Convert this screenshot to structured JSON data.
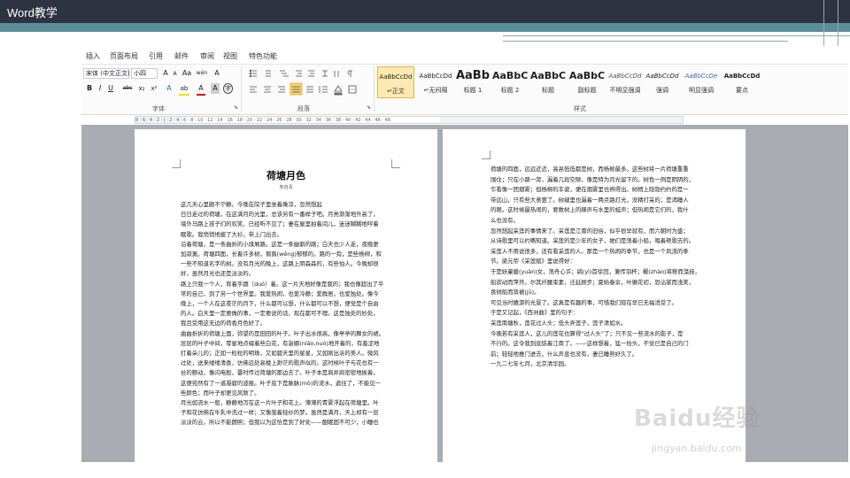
{
  "slide": {
    "title": "Word教学"
  },
  "menu": [
    "插入",
    "页面布局",
    "引用",
    "邮件",
    "审阅",
    "视图",
    "特色功能"
  ],
  "ribbon": {
    "font_name": "宋体 (中文正文)",
    "font_size": "小四",
    "font_group_label": "字体",
    "paragraph_group_label": "段落",
    "styles_group_label": "样式",
    "font_buttons": [
      "A",
      "A",
      "Aa",
      "wén",
      "A",
      "B",
      "I",
      "U",
      "abc",
      "x₂",
      "x²",
      "A",
      "ab",
      "A",
      "A",
      "字"
    ],
    "styles": [
      {
        "sample": "AaBbCcDd",
        "name": "↵正文"
      },
      {
        "sample": "AaBbCcDd",
        "name": "↵无间隔"
      },
      {
        "sample": "AaBb",
        "name": "标题 1"
      },
      {
        "sample": "AaBbC",
        "name": "标题 2"
      },
      {
        "sample": "AaBbC",
        "name": "标题"
      },
      {
        "sample": "AaBbC",
        "name": "副标题"
      },
      {
        "sample": "AaBbCcDd",
        "name": "不明显强调"
      },
      {
        "sample": "AaBbCcDd",
        "name": "强调"
      },
      {
        "sample": "AaBbCcDe",
        "name": "明显强调"
      },
      {
        "sample": "AaBbCcDd",
        "name": "要点"
      }
    ]
  },
  "ruler": "8 · 6 · 4 · 2 · | · 2 · 4 · 6 · 8 · 10 · 12 · 14 · 16 · 18 · 20 · 22 · 24 · 26 · 28 · 30 · 32 · 34 · 36 · 38 · 40 · 42 · 44 · 46 · 48",
  "doc": {
    "title": "荷塘月色",
    "author": "朱自清",
    "page1_lines": [
      "这几天心里颇不宁静。今晚在院子里坐着乘凉，忽然想起",
      "日日走过的荷塘，在这满月的光里，总该另有一番样子吧。月亮渐渐地升高了，",
      "墙外马路上孩子们的欢笑，已经听不见了；妻在屋里拍着闰儿，迷迷糊糊地哼着",
      "眠歌。我悄悄地披了大衫，带上门出去。",
      "沿着荷塘，是一条曲折的小煤屑路。这是一条幽僻的路；白天也少人走，夜晚更",
      "加寂寞。荷塘四面，长着许多树，蓊蓊(wěng)郁郁的。路的一旁，是些杨柳，和",
      "一些不知道名字的树。没有月光的晚上，这路上阴森森的，有些怕人。今晚却很",
      "好，虽然月光也还是淡淡的。",
      "路上只我一个人，背着手踱（duó）着。这一片天地好像是我的；我也像超出了平",
      "常的自己，到了另一个世界里。我爱热闹，也爱冷静；爱群居，也爱独处。像今",
      "晚上，一个人在这苍茫的月下，什么都可以想，什么都可以不想，便觉是个自由",
      "的人。白天里一定要做的事，一定要说的话，现在都可不理。这是独处的妙处，",
      "我且受用这无边的荷香月色好了。",
      "曲曲折折的荷塘上面，弥望的是田田的叶子。叶子出水很高，像亭亭的舞女的裙。",
      "层层的叶子中间，零星地点缀着些白花，有袅娜(niǎo,nuó)地开着的，有羞涩地",
      "打着朵儿的；正如一粒粒的明珠，又如碧天里的星星，又如刚出浴的美人。微风",
      "过处，送来缕缕清香，仿佛远处高楼上渺茫的歌声似的。这时候叶子与花也有一",
      "丝的颤动，像闪电般，霎时传过荷塘的那边去了。叶子本是肩并肩密密地挨着，",
      "这便宛然有了一道凝碧的波痕。叶子底下是脉脉(mò)的流水，遮住了，不能见一",
      "些颜色；而叶子却更见风致了。",
      "月光如流水一般，静静地泻在这一片叶子和花上。薄薄的青雾浮起在荷塘里。叶",
      "子和花仿佛在牛乳中洗过一样；又像笼着轻纱的梦。虽然是满月，天上却有一层",
      "淡淡的云，所以不能朗照；但我以为这恰是到了好处——酣眠固不可少，小睡也"
    ],
    "page2_lines": [
      "荷塘的四面，远远近近，高高低低都是树，而杨柳最多。这些树将一片荷塘重重",
      "围住；只在小路一旁，漏着几段空隙，像是特为月光留下的。树色一例是阴阴的，",
      "乍看像一团烟雾；但杨柳的丰姿，便在烟雾里也辨得出。树梢上隐隐约约的是一",
      "带远山，只有些大意罢了。树缝里也漏着一两点路灯光，没精打采的，是渴睡人",
      "的眼。这时候最热闹的，要数树上的蝉声与水里的蛙声；但热闹是它们的，我什",
      "么也没有。",
      "忽然想起采莲的事情来了。采莲是江南的旧俗，似乎很早就有，而六朝时为盛；",
      "从诗歌里可以约略知道。采莲的是少年的女子，她们是荡着小船，唱着艳歌去的。",
      "采莲人不用说很多，还有看采莲的人。那是一个热闹的季节，也是一个风流的季",
      "节。梁元帝《采莲赋》里说得好：",
      "于是妖童媛(yuàn)女，荡舟心许；鹢(yì)首徐回，兼传羽杯；櫂(zhào)将移而藻挂，",
      "船欲动而萍开。尔其纤腰束素，迁延顾步；夏始春余，叶嫩花初，恐沾裳而浅笑，",
      "畏倾船而敛裾(jū)。",
      "可见当时嬉游的光景了。这真是有趣的事，可惜我们现在早已无福消受了。",
      "于是又记起，《西洲曲》里的句子：",
      "采莲南塘秋，莲花过人头；低头弄莲子，莲子清如水。",
      "今晚若有采莲人，这儿的莲花也算得“过人头”了；只不见一些流水的影子，是",
      "不行的。这令我到底惦着江南了。——这样想着，猛一抬头，不觉已是自己的门",
      "前；轻轻地推门进去，什么声息也没有，妻已睡熟好久了。",
      "一九二七年七月，北京清华园。"
    ]
  },
  "watermark": {
    "brand": "Baidu经验",
    "url": "jingyan.baidu.com"
  }
}
